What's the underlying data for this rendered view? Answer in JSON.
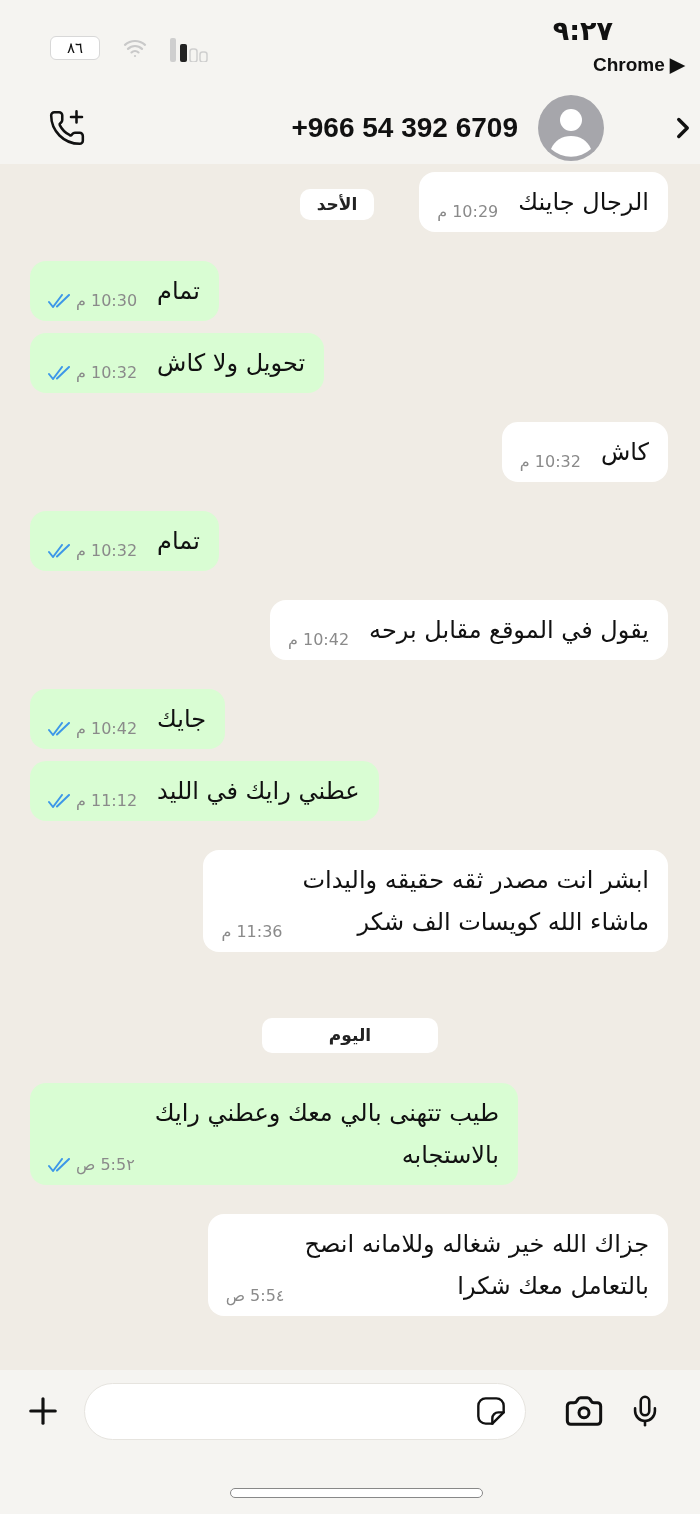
{
  "status_bar": {
    "time": "٩:٢٧",
    "return_app": "Chrome ▶",
    "battery": "٨٦"
  },
  "header": {
    "contact": "+966 54 392 6709"
  },
  "chat": {
    "sticky_date": "الأحد",
    "messages": [
      {
        "kind": "incoming",
        "text": "الرجال جاينك",
        "time": "10:29 م"
      },
      {
        "kind": "outgoing",
        "text": "تمام",
        "time": "10:30 م",
        "read": true
      },
      {
        "kind": "outgoing",
        "text": "تحويل ولا كاش",
        "time": "10:32 م",
        "read": true
      },
      {
        "kind": "incoming",
        "text": "كاش",
        "time": "10:32 م"
      },
      {
        "kind": "outgoing",
        "text": "تمام",
        "time": "10:32 م",
        "read": true
      },
      {
        "kind": "incoming",
        "text": "يقول في الموقع مقابل برحه",
        "time": "10:42 م"
      },
      {
        "kind": "outgoing",
        "text": "جايك",
        "time": "10:42 م",
        "read": true
      },
      {
        "kind": "outgoing",
        "text": "عطني رايك في الليد",
        "time": "11:12 م",
        "read": true
      },
      {
        "kind": "incoming",
        "text": "ابشر انت مصدر ثقه حقيقه واليدات\nماشاء الله كويسات الف شكر",
        "time": "11:36 م"
      },
      {
        "kind": "date",
        "label": "اليوم"
      },
      {
        "kind": "outgoing",
        "text": "طيب تتهنى بالي معك وعطني رايك\nبالاستجابه",
        "time": "5:5٢ ص",
        "read": true
      },
      {
        "kind": "incoming",
        "text": "جزاك الله خير شغاله وللامانه انصح\nبالتعامل معك شكرا",
        "time": "5:5٤ ص"
      }
    ]
  }
}
